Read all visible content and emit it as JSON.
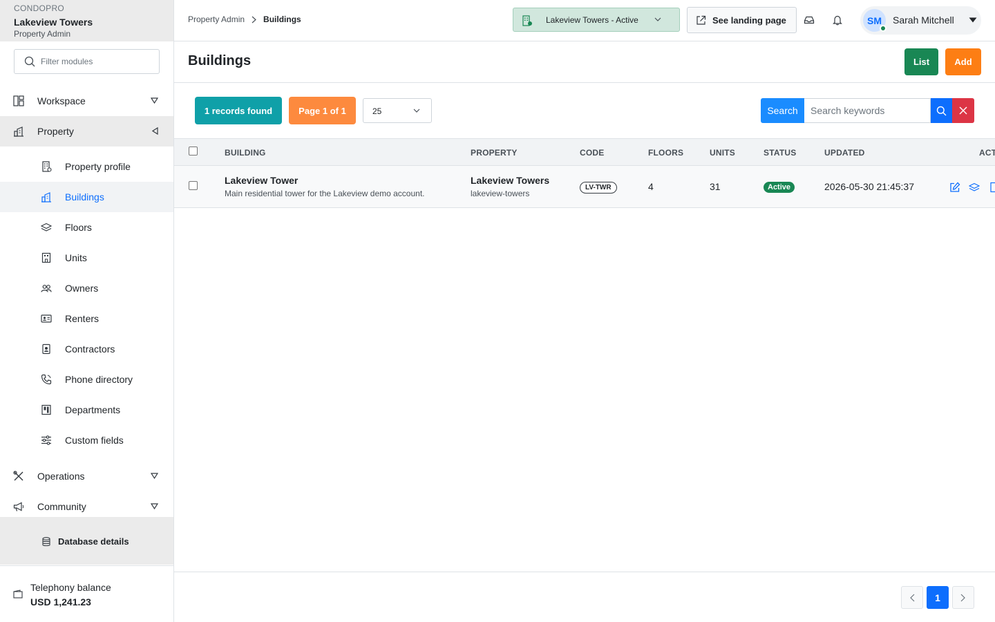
{
  "brand": {
    "kicker": "CONDOPRO",
    "property_name": "Lakeview Towers",
    "role": "Property Admin"
  },
  "sidebar": {
    "filter_placeholder": "Filter modules",
    "groups": {
      "workspace": "Workspace",
      "property": "Property",
      "operations": "Operations",
      "community": "Community"
    },
    "property_items": [
      {
        "label": "Property profile",
        "icon": "building-icon"
      },
      {
        "label": "Buildings",
        "icon": "chart-building-icon",
        "current": true
      },
      {
        "label": "Floors",
        "icon": "layers-icon"
      },
      {
        "label": "Units",
        "icon": "unit-icon"
      },
      {
        "label": "Owners",
        "icon": "people-icon"
      },
      {
        "label": "Renters",
        "icon": "id-card-icon"
      },
      {
        "label": "Contractors",
        "icon": "badge-icon"
      },
      {
        "label": "Phone directory",
        "icon": "phone-icon"
      },
      {
        "label": "Departments",
        "icon": "departments-icon"
      },
      {
        "label": "Custom fields",
        "icon": "sliders-icon"
      }
    ],
    "database_link": "Database details",
    "telephony": {
      "label": "Telephony balance",
      "value": "USD 1,241.23"
    }
  },
  "header": {
    "breadcrumb": [
      "Property Admin",
      "Buildings"
    ],
    "property_select": "Lakeview Towers - Active",
    "landing_button": "See landing page",
    "user": {
      "initials": "SM",
      "name": "Sarah Mitchell"
    }
  },
  "page": {
    "title": "Buildings",
    "list_button": "List",
    "add_button": "Add"
  },
  "toolbar": {
    "records_found": "1 records found",
    "page_info": "Page 1 of 1",
    "per_page": "25",
    "search_label": "Search",
    "search_placeholder": "Search keywords"
  },
  "table": {
    "columns": {
      "building": "BUILDING",
      "property": "PROPERTY",
      "code": "CODE",
      "floors": "FLOORS",
      "units": "UNITS",
      "status": "STATUS",
      "updated": "UPDATED",
      "actions": "ACTIONS"
    },
    "rows": [
      {
        "building": "Lakeview Tower",
        "building_desc": "Main residential tower for the Lakeview demo account.",
        "property": "Lakeview Towers",
        "property_slug": "lakeview-towers",
        "code": "LV-TWR",
        "floors": "4",
        "units": "31",
        "status": "Active",
        "updated": "2026-05-30 21:45:37"
      }
    ]
  },
  "pagination": {
    "current": "1"
  },
  "colors": {
    "primary": "#0d6efd",
    "success": "#198754",
    "teal": "#0fa0a8",
    "orange": "#fd7e14",
    "danger": "#dc3545"
  }
}
